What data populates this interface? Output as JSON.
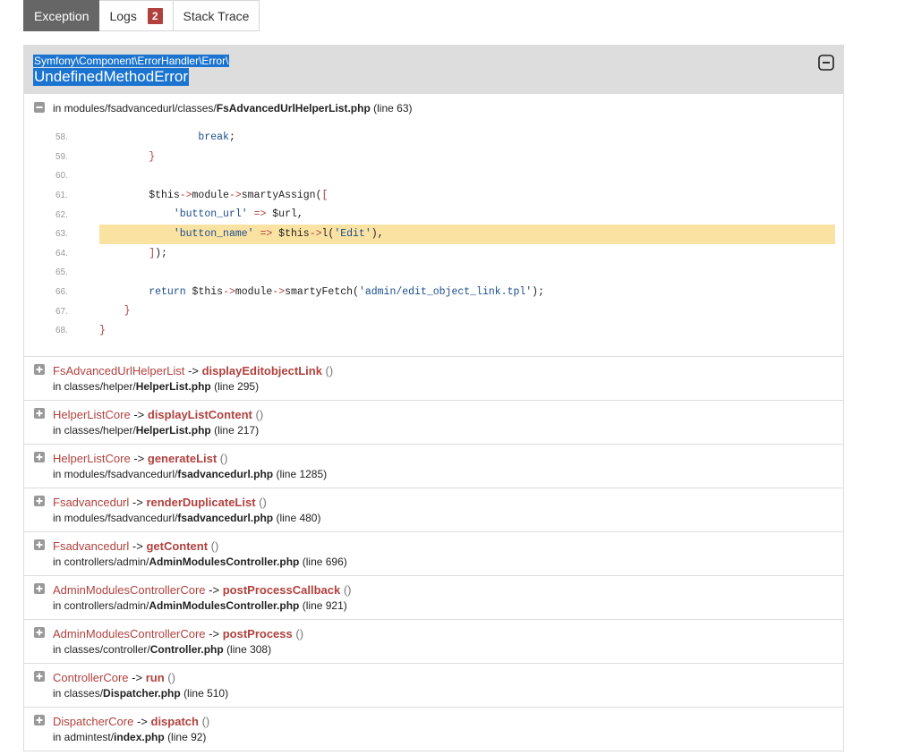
{
  "tabs": [
    {
      "label": "Exception",
      "active": true
    },
    {
      "label": "Logs",
      "badge": "2"
    },
    {
      "label": "Stack Trace"
    }
  ],
  "exception": {
    "class": "Symfony\\Component\\ErrorHandler\\Error\\",
    "title": "UndefinedMethodError"
  },
  "location": {
    "prefix": "in modules/fsadvancedurl/classes/",
    "file": "FsAdvancedUrlHelperList.php",
    "line": "(line 63)"
  },
  "code_lines": [
    {
      "n": "58."
    },
    {
      "n": "59."
    },
    {
      "n": "60."
    },
    {
      "n": "61."
    },
    {
      "n": "62."
    },
    {
      "n": "63."
    },
    {
      "n": "64."
    },
    {
      "n": "65."
    },
    {
      "n": "66."
    },
    {
      "n": "67."
    },
    {
      "n": "68."
    }
  ],
  "trace": [
    {
      "cls": "FsAdvancedUrlHelperList",
      "fn": "displayEditobjectLink",
      "path": "in classes/helper/",
      "file": "HelperList.php",
      "line": "(line 295)"
    },
    {
      "cls": "HelperListCore",
      "fn": "displayListContent",
      "path": "in classes/helper/",
      "file": "HelperList.php",
      "line": "(line 217)"
    },
    {
      "cls": "HelperListCore",
      "fn": "generateList",
      "path": "in modules/fsadvancedurl/",
      "file": "fsadvancedurl.php",
      "line": "(line 1285)"
    },
    {
      "cls": "Fsadvancedurl",
      "fn": "renderDuplicateList",
      "path": "in modules/fsadvancedurl/",
      "file": "fsadvancedurl.php",
      "line": "(line 480)"
    },
    {
      "cls": "Fsadvancedurl",
      "fn": "getContent",
      "path": "in controllers/admin/",
      "file": "AdminModulesController.php",
      "line": "(line 696)"
    },
    {
      "cls": "AdminModulesControllerCore",
      "fn": "postProcessCallback",
      "path": "in controllers/admin/",
      "file": "AdminModulesController.php",
      "line": "(line 921)"
    },
    {
      "cls": "AdminModulesControllerCore",
      "fn": "postProcess",
      "path": "in classes/controller/",
      "file": "Controller.php",
      "line": "(line 308)"
    },
    {
      "cls": "ControllerCore",
      "fn": "run",
      "path": "in classes/",
      "file": "Dispatcher.php",
      "line": "(line 510)"
    },
    {
      "cls": "DispatcherCore",
      "fn": "dispatch",
      "path": "in admintest/",
      "file": "index.php",
      "line": "(line 92)"
    }
  ],
  "colors": {
    "accent": "#b0413e",
    "highlight": "#fae3a2",
    "selection": "#1b74d0",
    "header_bg": "#dddddd",
    "tab_active": "#666666"
  }
}
